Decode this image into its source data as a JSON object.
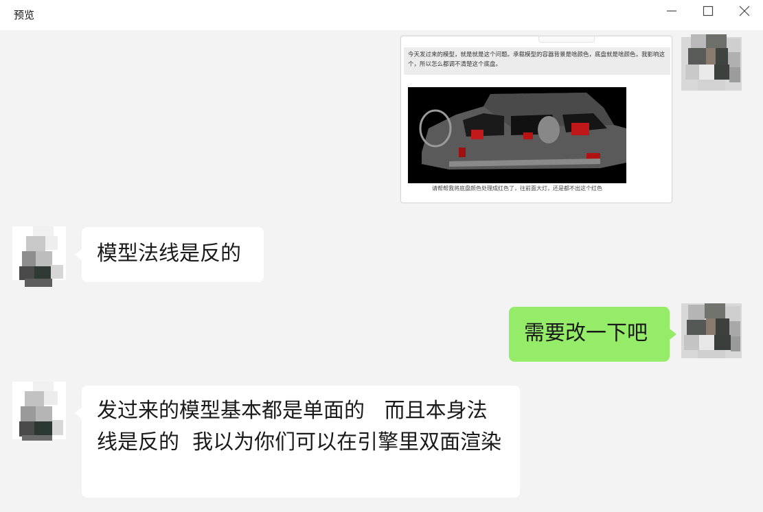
{
  "window": {
    "title": "预览",
    "controls": {
      "minimize": "minimize-icon",
      "maximize": "maximize-icon",
      "close": "close-icon"
    }
  },
  "quoted_screenshot": {
    "quote_text": "今天发过来的模型，就是就是这个问题。承载模型的容器背景是啥颜色，底盘就是啥颜色，我影响这个，所以怎么都调不清楚这个底盘。",
    "image_caption": "请帮帮我将底盘颜色处理成红色了，往前面大灯，还是都不出这个红色"
  },
  "messages": [
    {
      "side": "incoming",
      "text": "模型法线是反的"
    },
    {
      "side": "outgoing",
      "text": "需要改一下吧"
    },
    {
      "side": "incoming",
      "text": "发过来的模型基本都是单面的   而且本身法线是反的  我以为你们可以在引擎里双面渲染"
    }
  ],
  "colors": {
    "background": "#f3f3f3",
    "incoming_bubble": "#ffffff",
    "outgoing_bubble": "#95ec69",
    "titlebar": "#ffffff"
  }
}
